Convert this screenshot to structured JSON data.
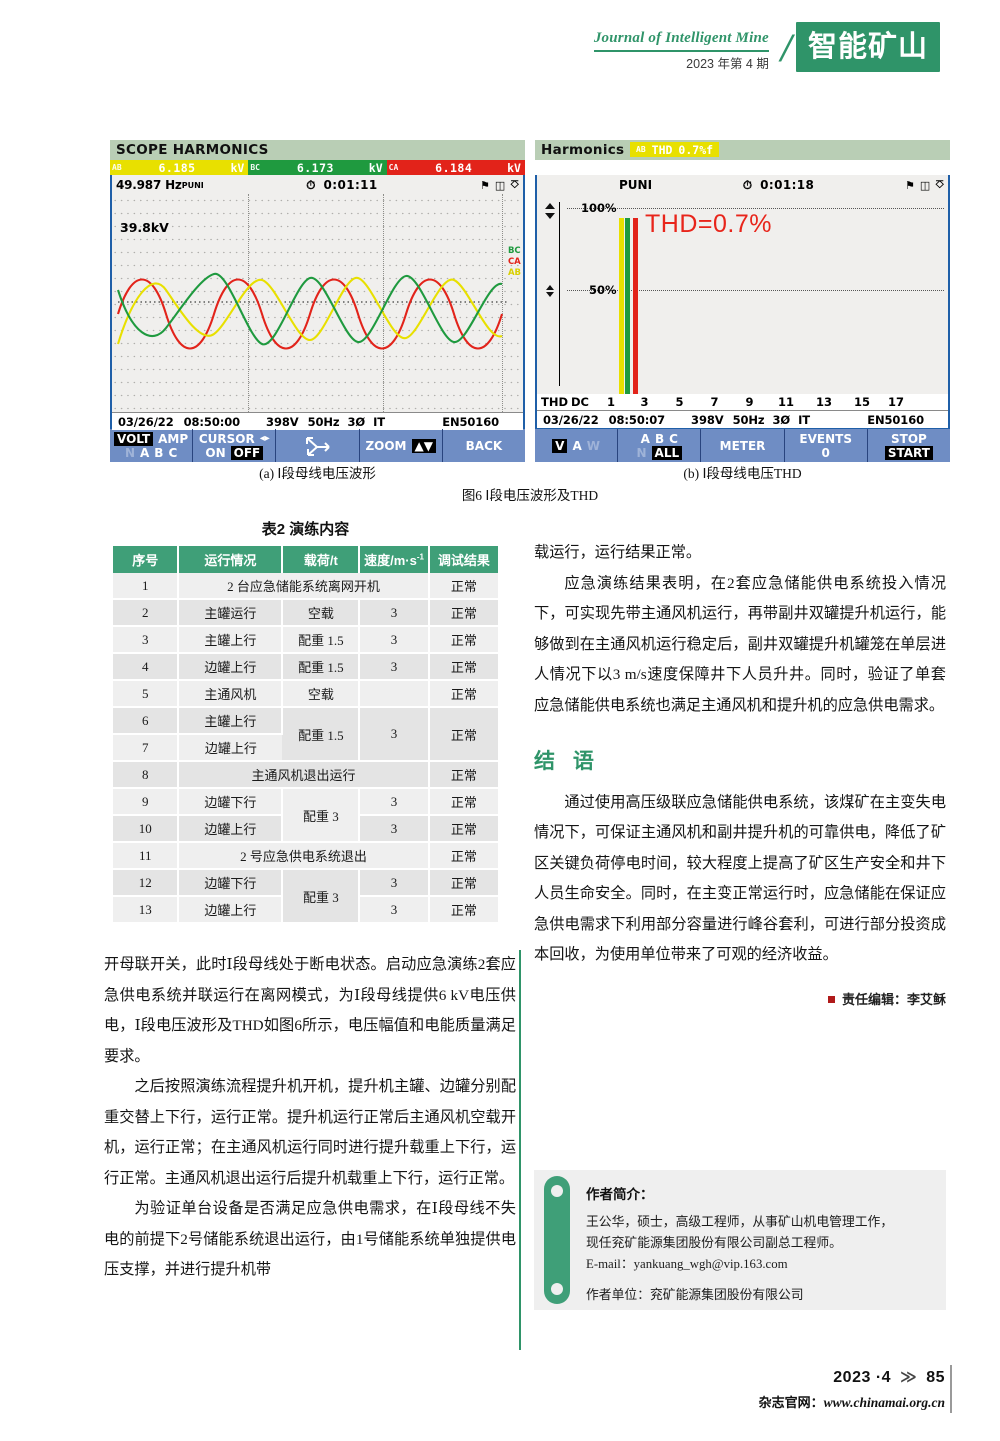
{
  "running_head": {
    "journal_en": "Journal of Intelligent Mine",
    "issue": "2023 年第 4 期",
    "slash": "/",
    "logo": "智能矿山"
  },
  "figure": {
    "caption_a": "(a) Ⅰ段母线电压波形",
    "caption_b": "(b) Ⅰ段母线电压THD",
    "caption_main": "图6 Ⅰ段电压波形及THD",
    "meter_left": {
      "title": "SCOPE HARMONICS",
      "phases": [
        {
          "tag": "AB",
          "value": "6.185",
          "unit": "kV",
          "color": "#e8e000"
        },
        {
          "tag": "BC",
          "value": "6.173",
          "unit": "kV",
          "color": "#1f9a3f"
        },
        {
          "tag": "CA",
          "value": "6.184",
          "unit": "kV",
          "color": "#e2231a"
        }
      ],
      "freq": "49.987 Hz",
      "freq_sub": "PUNI",
      "timer": "0:01:11",
      "scale": "39.8kV",
      "wave_labels": {
        "bc": "BC",
        "ca": "CA",
        "ab": "AB"
      },
      "status": {
        "date": "03/26/22",
        "time": "08:50:00",
        "voltage": "398V",
        "frequency": "50Hz",
        "phase": "3Ø",
        "system": "IT",
        "standard": "EN50160"
      },
      "keys": [
        {
          "row1": [
            "VOLT",
            "AMP"
          ],
          "row2": [
            "N",
            "A",
            "B",
            "C"
          ],
          "active": "VOLT"
        },
        {
          "row1": [
            "CURSOR"
          ],
          "row2": [
            "ON",
            "OFF"
          ],
          "active": "OFF"
        },
        {
          "row1": [
            "move-icon"
          ],
          "row2": []
        },
        {
          "row1": [
            "ZOOM"
          ],
          "row2": []
        },
        {
          "row1": [
            "BACK"
          ],
          "row2": []
        }
      ]
    },
    "meter_right": {
      "title": "Harmonics",
      "thd_badge": {
        "tag": "AB",
        "label": "THD",
        "value": "0.7%f"
      },
      "freq_sub": "PUNI",
      "timer": "0:01:18",
      "annotation": "THD=0.7%",
      "annotation_color": "#e8251b",
      "y_labels": [
        "100%",
        "50%"
      ],
      "x_labels": [
        "THD",
        "DC",
        "1",
        "3",
        "5",
        "7",
        "9",
        "11",
        "13",
        "15",
        "17"
      ],
      "bars": [
        {
          "harmonic": "1",
          "phase": "AB",
          "value": 100,
          "color": "#e8e000"
        },
        {
          "harmonic": "1",
          "phase": "BC",
          "value": 100,
          "color": "#1f9a3f"
        },
        {
          "harmonic": "1",
          "phase": "CA",
          "value": 100,
          "color": "#e2231a"
        }
      ],
      "status": {
        "date": "03/26/22",
        "time": "08:50:07",
        "voltage": "398V",
        "frequency": "50Hz",
        "phase": "3Ø",
        "system": "IT",
        "standard": "EN50160"
      },
      "keys": [
        {
          "row1": [
            "V",
            "A",
            "W"
          ],
          "active": "V"
        },
        {
          "row1": [
            "A",
            "B",
            "C"
          ],
          "row2": [
            "N",
            "ALL"
          ],
          "active": "ALL"
        },
        {
          "row1": [
            "METER"
          ],
          "row2": []
        },
        {
          "row1": [
            "EVENTS"
          ],
          "row2": [
            "0"
          ]
        },
        {
          "row1": [
            "STOP"
          ],
          "row2": [
            "START"
          ],
          "active": "START"
        }
      ]
    }
  },
  "table": {
    "title": "表2 演练内容",
    "headers": [
      "序号",
      "运行情况",
      "载荷/t",
      "速度/m·s",
      "调试结果"
    ],
    "speed_superscript": "-1",
    "rows": [
      {
        "no": "1",
        "op": "2 台应急储能系统离网开机",
        "span": true,
        "load": "",
        "speed": "",
        "result": "正常"
      },
      {
        "no": "2",
        "op": "主罐运行",
        "load": "空载",
        "speed": "3",
        "result": "正常"
      },
      {
        "no": "3",
        "op": "主罐上行",
        "load": "配重 1.5",
        "speed": "3",
        "result": "正常"
      },
      {
        "no": "4",
        "op": "边罐上行",
        "load": "配重 1.5",
        "speed": "3",
        "result": "正常"
      },
      {
        "no": "5",
        "op": "主通风机",
        "load": "空载",
        "speed": "",
        "result": "正常"
      },
      {
        "no": "6",
        "op": "主罐上行",
        "load": "配重 1.5",
        "speed": "3",
        "result": "正常",
        "load_rowspan": 2,
        "speed_rowspan": 2,
        "result_rowspan": 2
      },
      {
        "no": "7",
        "op": "边罐上行",
        "load": "",
        "speed": "",
        "result": ""
      },
      {
        "no": "8",
        "op": "主通风机退出运行",
        "span": true,
        "load": "",
        "speed": "",
        "result": "正常"
      },
      {
        "no": "9",
        "op": "边罐下行",
        "load": "配重 3",
        "speed": "3",
        "result": "正常",
        "load_rowspan": 2
      },
      {
        "no": "10",
        "op": "边罐上行",
        "load": "",
        "speed": "3",
        "result": "正常"
      },
      {
        "no": "11",
        "op": "2 号应急供电系统退出",
        "span": true,
        "load": "",
        "speed": "",
        "result": "正常"
      },
      {
        "no": "12",
        "op": "边罐下行",
        "load": "配重 3",
        "speed": "3",
        "result": "正常",
        "load_rowspan": 2
      },
      {
        "no": "13",
        "op": "边罐上行",
        "load": "",
        "speed": "3",
        "result": "正常"
      }
    ]
  },
  "left_column": {
    "p1": "开母联开关，此时Ⅰ段母线处于断电状态。启动应急演练2套应急供电系统并联运行在离网模式，为Ⅰ段母线提供6 kV电压供电，Ⅰ段电压波形及THD如图6所示，电压幅值和电能质量满足要求。",
    "p2": "之后按照演练流程提升机开机，提升机主罐、边罐分别配重交替上下行，运行正常。提升机运行正常后主通风机空载开机，运行正常；在主通风机运行同时进行提升载重上下行，运行正常。主通风机退出运行后提升机载重上下行，运行正常。",
    "p3": "为验证单台设备是否满足应急供电需求，在Ⅰ段母线不失电的前提下2号储能系统退出运行，由1号储能系统单独提供电压支撑，并进行提升机带"
  },
  "right_column": {
    "p1": "载运行，运行结果正常。",
    "p2": "应急演练结果表明，在2套应急储能供电系统投入情况下，可实现先带主通风机运行，再带副井双罐提升机运行，能够做到在主通风机运行稳定后，副井双罐提升机罐笼在单层进人情况下以3 m/s速度保障井下人员升井。同时，验证了单套应急储能供电系统也满足主通风机和提升机的应急供电需求。",
    "section_heading": "结 语",
    "p3": "通过使用高压级联应急储能供电系统，该煤矿在主变失电情况下，可保证主通风机和副井提升机的可靠供电，降低了矿区关键负荷停电时间，较大程度上提高了矿区生产安全和井下人员生命安全。同时，在主变正常运行时，应急储能在保证应急供电需求下利用部分容量进行峰谷套利，可进行部分投资成本回收，为使用单位带来了可观的经济收益。",
    "editor": "责任编辑：李艾稣"
  },
  "author_box": {
    "title": "作者简介：",
    "line1": "王公华，硕士，高级工程师，从事矿山机电管理工作，",
    "line2": "现任兖矿能源集团股份有限公司副总工程师。",
    "email": "E-mail：yankuang_wgh@vip.163.com",
    "affiliation": "作者单位：兖矿能源集团股份有限公司"
  },
  "footer": {
    "issue": "2023 ·4",
    "arrow": "≫",
    "page": "85",
    "site_label": "杂志官网：",
    "site_url": "www.chinamai.org.cn"
  },
  "colors": {
    "brand_green": "#2f9469",
    "table_header": "#3f9f78",
    "accent_red": "#e8251b",
    "meter_blue": "#1f5fa8",
    "key_blue": "#6f8dc4"
  }
}
